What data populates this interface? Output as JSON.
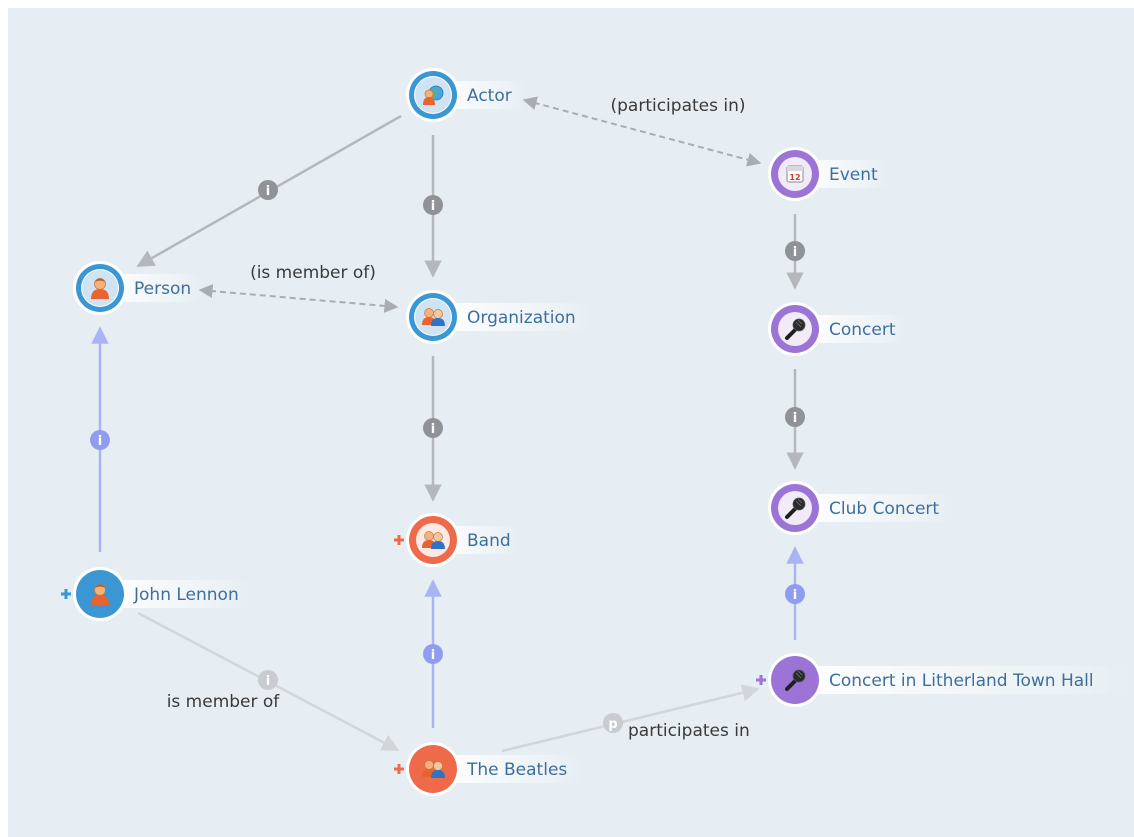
{
  "colors": {
    "canvas_bg": "#e6eef3",
    "class_blue": "#3b97d3",
    "class_purple": "#9b74d6",
    "instance_orange": "#ef6a4a",
    "edge_gray": "#b4b8bc",
    "edge_blue": "#aab4f5",
    "edge_light": "#d2d6da",
    "badge_gray": "#8f9397",
    "badge_blue": "#8f9cf0",
    "badge_light": "#c8cbcf",
    "label_text": "#3d6f9e",
    "expand_blue": "#3b97d3",
    "expand_orange": "#ef6a4a",
    "expand_purple": "#9b74d6"
  },
  "nodes": [
    {
      "id": "actor",
      "label": "Actor",
      "kind": "class",
      "color": "#3b97d3",
      "icon": "actor-globe-icon",
      "expand": false
    },
    {
      "id": "event",
      "label": "Event",
      "kind": "class",
      "color": "#9b74d6",
      "icon": "calendar-icon",
      "expand": false
    },
    {
      "id": "person",
      "label": "Person",
      "kind": "class",
      "color": "#3b97d3",
      "icon": "person-icon",
      "expand": false
    },
    {
      "id": "organization",
      "label": "Organization",
      "kind": "class",
      "color": "#3b97d3",
      "icon": "group-icon",
      "expand": false
    },
    {
      "id": "concert",
      "label": "Concert",
      "kind": "class",
      "color": "#9b74d6",
      "icon": "microphone-icon",
      "expand": false
    },
    {
      "id": "clubconcert",
      "label": "Club Concert",
      "kind": "class",
      "color": "#9b74d6",
      "icon": "microphone-icon",
      "expand": false
    },
    {
      "id": "band",
      "label": "Band",
      "kind": "class",
      "color": "#ef6a4a",
      "icon": "group-icon",
      "expand": true
    },
    {
      "id": "john",
      "label": "John Lennon",
      "kind": "instance",
      "color": "#3b97d3",
      "icon": "person-icon",
      "expand": true
    },
    {
      "id": "beatles",
      "label": "The Beatles",
      "kind": "instance",
      "color": "#ef6a4a",
      "icon": "group-icon",
      "expand": true
    },
    {
      "id": "litherland",
      "label": "Concert in Litherland Town Hall",
      "kind": "instance",
      "color": "#9b74d6",
      "icon": "microphone-icon",
      "expand": true
    }
  ],
  "edges": [
    {
      "id": "actor-person",
      "from": "actor",
      "to": "person",
      "style": "solid",
      "color": "#b4b8bc",
      "badge": "i",
      "label": ""
    },
    {
      "id": "actor-organization",
      "from": "actor",
      "to": "organization",
      "style": "solid",
      "color": "#b4b8bc",
      "badge": "i",
      "label": ""
    },
    {
      "id": "actor-event",
      "from": "actor",
      "to": "event",
      "style": "dashed",
      "color": "#a9adb1",
      "badge": "",
      "label": "(participates in)"
    },
    {
      "id": "person-organization",
      "from": "person",
      "to": "organization",
      "style": "dashed",
      "color": "#a9adb1",
      "badge": "",
      "label": "(is member of)"
    },
    {
      "id": "organization-band",
      "from": "organization",
      "to": "band",
      "style": "solid",
      "color": "#b4b8bc",
      "badge": "i",
      "label": ""
    },
    {
      "id": "event-concert",
      "from": "event",
      "to": "concert",
      "style": "solid",
      "color": "#b4b8bc",
      "badge": "i",
      "label": ""
    },
    {
      "id": "concert-clubconcert",
      "from": "concert",
      "to": "clubconcert",
      "style": "solid",
      "color": "#b4b8bc",
      "badge": "i",
      "label": ""
    },
    {
      "id": "john-person",
      "from": "john",
      "to": "person",
      "style": "solid",
      "color": "#aab4f5",
      "badge": "i",
      "label": ""
    },
    {
      "id": "beatles-band",
      "from": "beatles",
      "to": "band",
      "style": "solid",
      "color": "#aab4f5",
      "badge": "i",
      "label": ""
    },
    {
      "id": "litherland-clubconcert",
      "from": "litherland",
      "to": "clubconcert",
      "style": "solid",
      "color": "#aab4f5",
      "badge": "i",
      "label": ""
    },
    {
      "id": "john-beatles",
      "from": "john",
      "to": "beatles",
      "style": "solid",
      "color": "#d2d6da",
      "badge": "i",
      "label": "is member of"
    },
    {
      "id": "beatles-litherland",
      "from": "beatles",
      "to": "litherland",
      "style": "solid",
      "color": "#d2d6da",
      "badge": "p",
      "label": "participates in"
    }
  ]
}
